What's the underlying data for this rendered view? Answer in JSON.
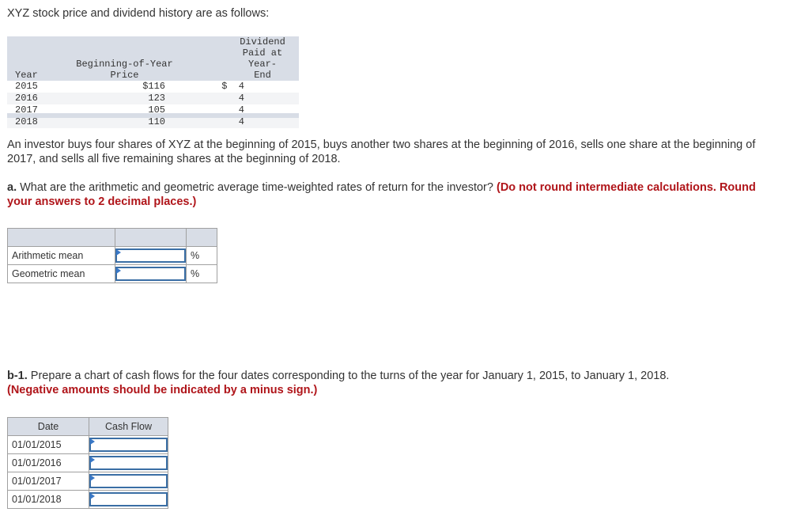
{
  "intro": "XYZ stock price and dividend history are as follows:",
  "stock_table": {
    "headers": {
      "year": "Year",
      "price_line1": "Beginning-of-Year",
      "price_line2": "Price",
      "div_line1": "Dividend Paid at Year-",
      "div_line2": "End"
    },
    "rows": [
      {
        "year": "2015",
        "price": "$116",
        "dividend": "$  4"
      },
      {
        "year": "2016",
        "price": "123",
        "dividend": "4"
      },
      {
        "year": "2017",
        "price": "105",
        "dividend": "4"
      },
      {
        "year": "2018",
        "price": "110",
        "dividend": "4"
      }
    ]
  },
  "scenario": "An investor buys four shares of XYZ at the beginning of 2015, buys another two shares at the beginning of 2016, sells one share at the beginning of 2017, and sells all five remaining shares at the beginning of 2018.",
  "part_a": {
    "label": "a.",
    "question": " What are the arithmetic and geometric average time-weighted rates of return for the investor? ",
    "instruction": "(Do not round intermediate calculations. Round your answers to 2 decimal places.)",
    "rows": [
      {
        "label": "Arithmetic mean",
        "value": "",
        "unit": "%"
      },
      {
        "label": "Geometric mean",
        "value": "",
        "unit": "%"
      }
    ]
  },
  "part_b1": {
    "label": "b-1.",
    "question": " Prepare a chart of cash flows for the four dates corresponding to the turns of the year for January 1, 2015, to January 1, 2018.",
    "instruction": "(Negative amounts should be indicated by a minus sign.)",
    "headers": {
      "date": "Date",
      "cash_flow": "Cash Flow"
    },
    "rows": [
      {
        "date": "01/01/2015",
        "value": ""
      },
      {
        "date": "01/01/2016",
        "value": ""
      },
      {
        "date": "01/01/2017",
        "value": ""
      },
      {
        "date": "01/01/2018",
        "value": ""
      }
    ]
  }
}
